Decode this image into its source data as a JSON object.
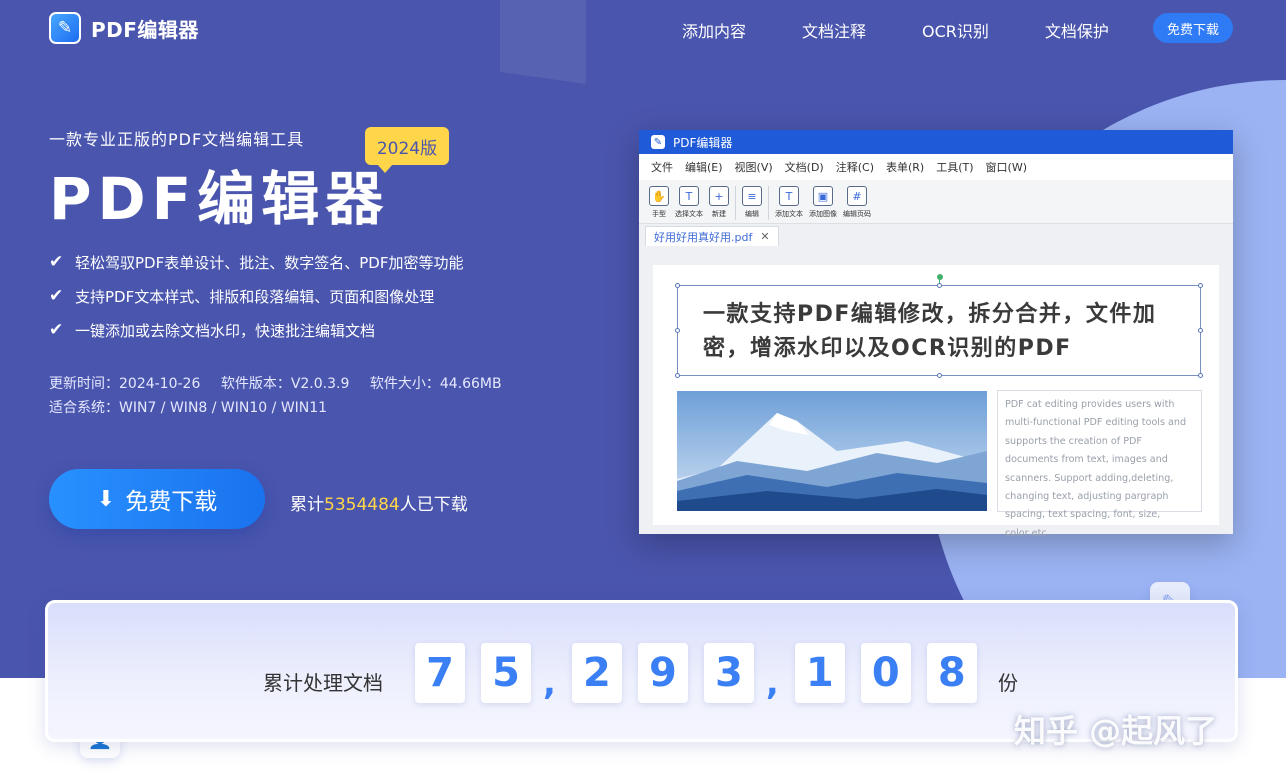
{
  "header": {
    "logo_text": "PDF编辑器",
    "nav": [
      "添加内容",
      "文档注释",
      "OCR识别",
      "文档保护"
    ],
    "download_btn": "免费下载"
  },
  "hero": {
    "subtitle": "一款专业正版的PDF文档编辑工具",
    "title": "PDF编辑器",
    "version_badge": "2024版",
    "features": [
      "轻松驾驭PDF表单设计、批注、数字签名、PDF加密等功能",
      "支持PDF文本样式、排版和段落编辑、页面和图像处理",
      "一键添加或去除文档水印，快速批注编辑文档"
    ],
    "meta": {
      "update": "更新时间：2024-10-26",
      "version": "软件版本：V2.0.3.9",
      "size": "软件大小：44.66MB",
      "system": "适合系统：WIN7 / WIN8 / WIN10 / WIN11"
    },
    "download_label": "免费下载",
    "count_prefix": "累计",
    "count_number": "5354484",
    "count_suffix": "人已下载"
  },
  "app": {
    "title": "PDF编辑器",
    "menus": [
      "文件",
      "编辑(E)",
      "视图(V)",
      "文档(D)",
      "注释(C)",
      "表单(R)",
      "工具(T)",
      "窗口(W)"
    ],
    "tools": [
      "手型",
      "选择文本",
      "新建",
      "编辑",
      "添加文本",
      "添加图像",
      "编辑页码"
    ],
    "file_tab": "好用好用真好用.pdf",
    "selected_text": "一款支持PDF编辑修改，拆分合并，文件加密，增添水印以及OCR识别的PDF",
    "side_text": "PDF cat editing provides users with multi-functional PDF editing tools and supports the creation of PDF documents from text, images and scanners. Support adding,deleting, changing text, adjusting pargraph spacing, text spacing, font, size, color,etc."
  },
  "stats": {
    "label": "累计处理文档",
    "digits": [
      "7",
      "5",
      "2",
      "9",
      "3",
      "1",
      "0",
      "8"
    ],
    "comma": ",",
    "unit": "份"
  },
  "watermark": "知乎 @起风了"
}
